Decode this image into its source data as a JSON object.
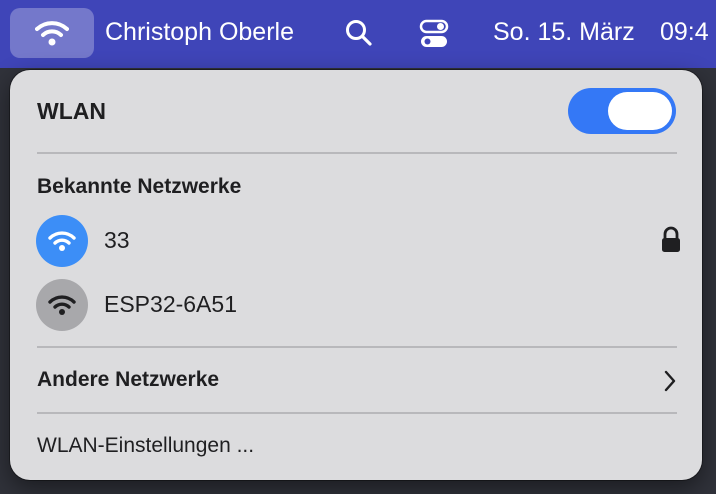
{
  "menubar": {
    "user_name": "Christoph Oberle",
    "date": "So. 15. März",
    "time": "09:4",
    "wifi_icon": "wifi-icon",
    "search_icon": "search-icon",
    "control_center_icon": "control-center-icon"
  },
  "wlan_panel": {
    "title": "WLAN",
    "toggle_on": true,
    "known_networks_title": "Bekannte Netzwerke",
    "known_networks": [
      {
        "name": "33",
        "connected": true,
        "secured": true
      },
      {
        "name": "ESP32-6A51",
        "connected": false,
        "secured": false
      }
    ],
    "other_networks_label": "Andere Netzwerke",
    "settings_label": "WLAN-Einstellungen ..."
  },
  "colors": {
    "menubar_bg": "#3f45b8",
    "toggle_on": "#3478f6",
    "active_network": "#3c8ef7",
    "inactive_network": "#a8a8ab",
    "panel_bg": "#dcdcde"
  }
}
